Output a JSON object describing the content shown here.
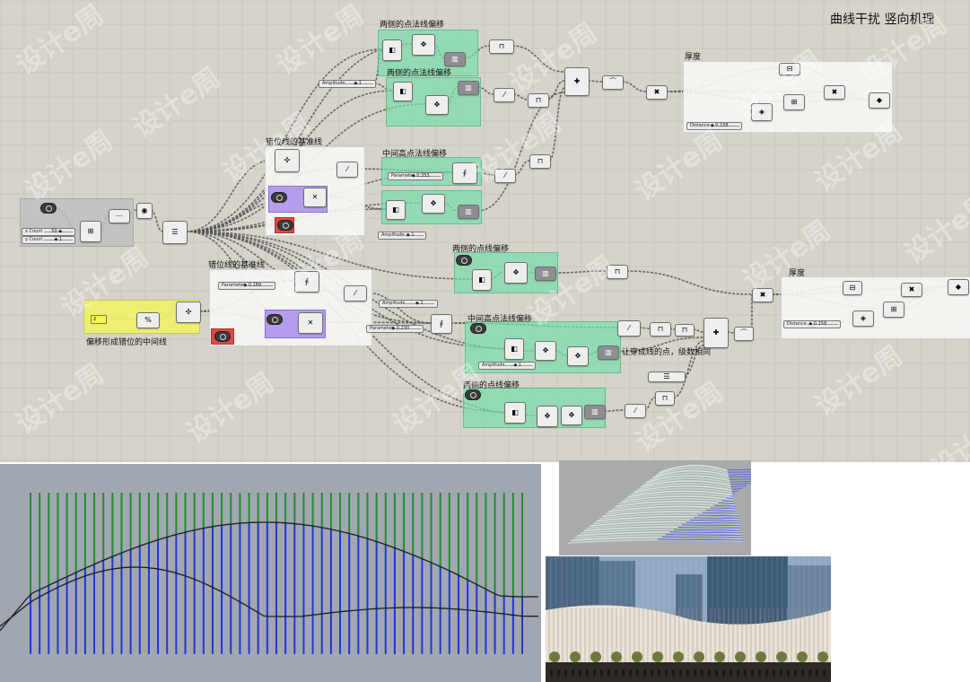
{
  "title": "曲线干扰 竖向机理",
  "labels": {
    "lbl_top1": "两侧的点法线偏移",
    "lbl_top2": "两侧的点法线偏移",
    "lbl_thick1": "厚度",
    "lbl_base1": "错位线的基准线",
    "lbl_mid1": "中间高点法线偏移",
    "lbl_side2": "两侧的点线偏移",
    "lbl_thick2": "厚度",
    "lbl_base2": "错位线的基准线",
    "lbl_mid2": "中间高点法线偏移",
    "lbl_side3": "两侧的点线偏移",
    "lbl_offset": "偏移形成错位的中间线",
    "lbl_pass": "让穿成线的点，级数相同"
  },
  "sliders": {
    "s_amp1": {
      "label": "Amplitude",
      "value": "◆ 1"
    },
    "s_param1": {
      "label": "Parameter",
      "value": "◆ 0.353"
    },
    "s_amp2": {
      "label": "Amplitude",
      "value": "◆ 1"
    },
    "s_dist1": {
      "label": "Distance",
      "value": "◆ 0.158"
    },
    "s_count": {
      "label": "x Count",
      "value": "50 ◆"
    },
    "s_ycount": {
      "label": "y Count",
      "value": "◆ 1"
    },
    "s_param2": {
      "label": "Parameter",
      "value": "◆ 0.189"
    },
    "s_amp3": {
      "label": "Amplitude",
      "value": "◆ 1"
    },
    "s_param3": {
      "label": "Parameter",
      "value": "◆ 0.230"
    },
    "s_amp4": {
      "label": "Amplitude",
      "value": "◆ 1"
    },
    "s_dist2": {
      "label": "Distance",
      "value": "◆ 0.158"
    }
  },
  "panel_value": "2",
  "colors": {
    "canvas": "#d6d3cb",
    "green_group": "#78dcaa",
    "purple_group": "#a587eb",
    "yellow_group": "#f0f06e",
    "red_toggle": "#e24a4a",
    "wire": "#555555",
    "line_green": "#1f8f2a",
    "line_blue": "#2236d6",
    "curve": "#1c1c1c"
  },
  "plot": {
    "line_count": 55,
    "green_color": "#1f8f2a",
    "blue_color": "#2236d6"
  },
  "watermark": "设计e周"
}
